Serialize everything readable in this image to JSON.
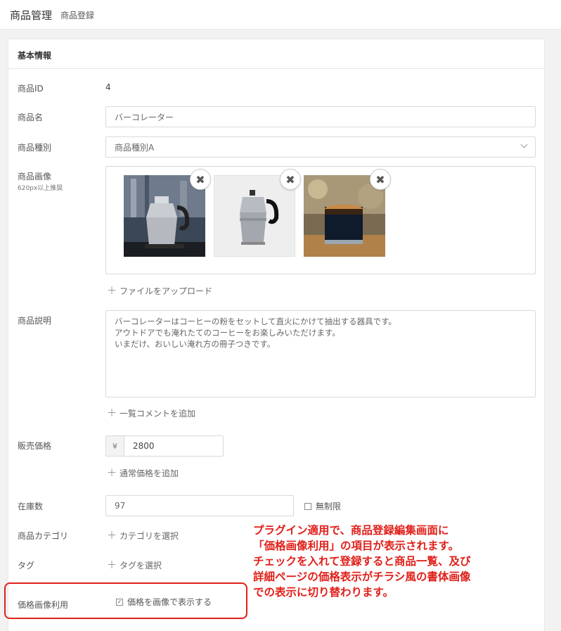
{
  "header": {
    "title": "商品管理",
    "subtitle": "商品登録"
  },
  "card": {
    "title": "基本情報"
  },
  "fields": {
    "product_id": {
      "label": "商品ID",
      "value": "4"
    },
    "product_name": {
      "label": "商品名",
      "value": "バーコレーター"
    },
    "product_type": {
      "label": "商品種別",
      "value": "商品種別A"
    },
    "product_images": {
      "label": "商品画像",
      "sub": "620px以上推奨",
      "images": [
        "percolator-on-stove",
        "percolator-white-bg",
        "coffee-glass"
      ],
      "upload_label": "ファイルをアップロード"
    },
    "description": {
      "label": "商品説明",
      "lines": [
        "バーコレーターはコーヒーの粉をセットして直火にかけて抽出する器具です。",
        "アウトドアでも淹れたてのコーヒーをお楽しみいただけます。",
        "いまだけ、おいしい淹れ方の冊子つきです。"
      ],
      "add_comment_label": "一覧コメントを追加"
    },
    "price": {
      "label": "販売価格",
      "currency": "¥",
      "value": "2800",
      "add_regular_label": "通常価格を追加"
    },
    "stock": {
      "label": "在庫数",
      "value": "97",
      "unlimited_label": "無制限"
    },
    "category": {
      "label": "商品カテゴリ",
      "select_label": "カテゴリを選択"
    },
    "tag": {
      "label": "タグ",
      "select_label": "タグを選択"
    },
    "price_image": {
      "label": "価格画像利用",
      "checkbox_label": "価格を画像で表示する",
      "checked": true
    }
  },
  "annotation": {
    "lines": [
      "プラグイン適用で、商品登録編集画面に",
      "「価格画像利用」の項目が表示されます。",
      "チェックを入れて登録すると商品一覧、及び",
      "詳細ページの価格表示がチラシ風の書体画像",
      "での表示に切り替わります。"
    ],
    "color": "#e0201a"
  }
}
